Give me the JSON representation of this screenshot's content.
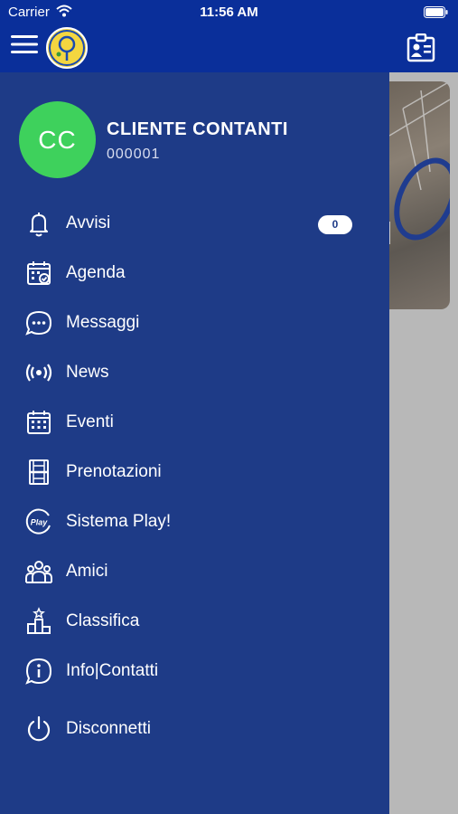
{
  "status_bar": {
    "carrier": "Carrier",
    "time": "11:56 AM"
  },
  "header": {
    "menu_icon": "hamburger-icon",
    "logo": "club-logo",
    "right_icon": "id-card-icon"
  },
  "user": {
    "initials": "CC",
    "name": "CLIENTE CONTANTI",
    "code": "000001",
    "avatar_color": "#3ed15c"
  },
  "menu": [
    {
      "label": "Avvisi",
      "icon": "bell-icon",
      "badge": "0"
    },
    {
      "label": "Agenda",
      "icon": "calendar-check-icon"
    },
    {
      "label": "Messaggi",
      "icon": "chat-bubble-icon"
    },
    {
      "label": "News",
      "icon": "broadcast-icon"
    },
    {
      "label": "Eventi",
      "icon": "calendar-grid-icon"
    },
    {
      "label": "Prenotazioni",
      "icon": "court-icon"
    },
    {
      "label": "Sistema Play!",
      "icon": "play-badge-icon",
      "icon_text": "Play"
    },
    {
      "label": "Amici",
      "icon": "friends-icon"
    },
    {
      "label": "Classifica",
      "icon": "podium-icon"
    },
    {
      "label": "Info|Contatti",
      "icon": "info-icon"
    },
    {
      "label": "Disconnetti",
      "icon": "power-icon"
    }
  ],
  "colors": {
    "header": "#0a2f9a",
    "drawer": "#1e3b87",
    "overlay": "#b8b8b8",
    "badge_bg": "#ffffff"
  }
}
